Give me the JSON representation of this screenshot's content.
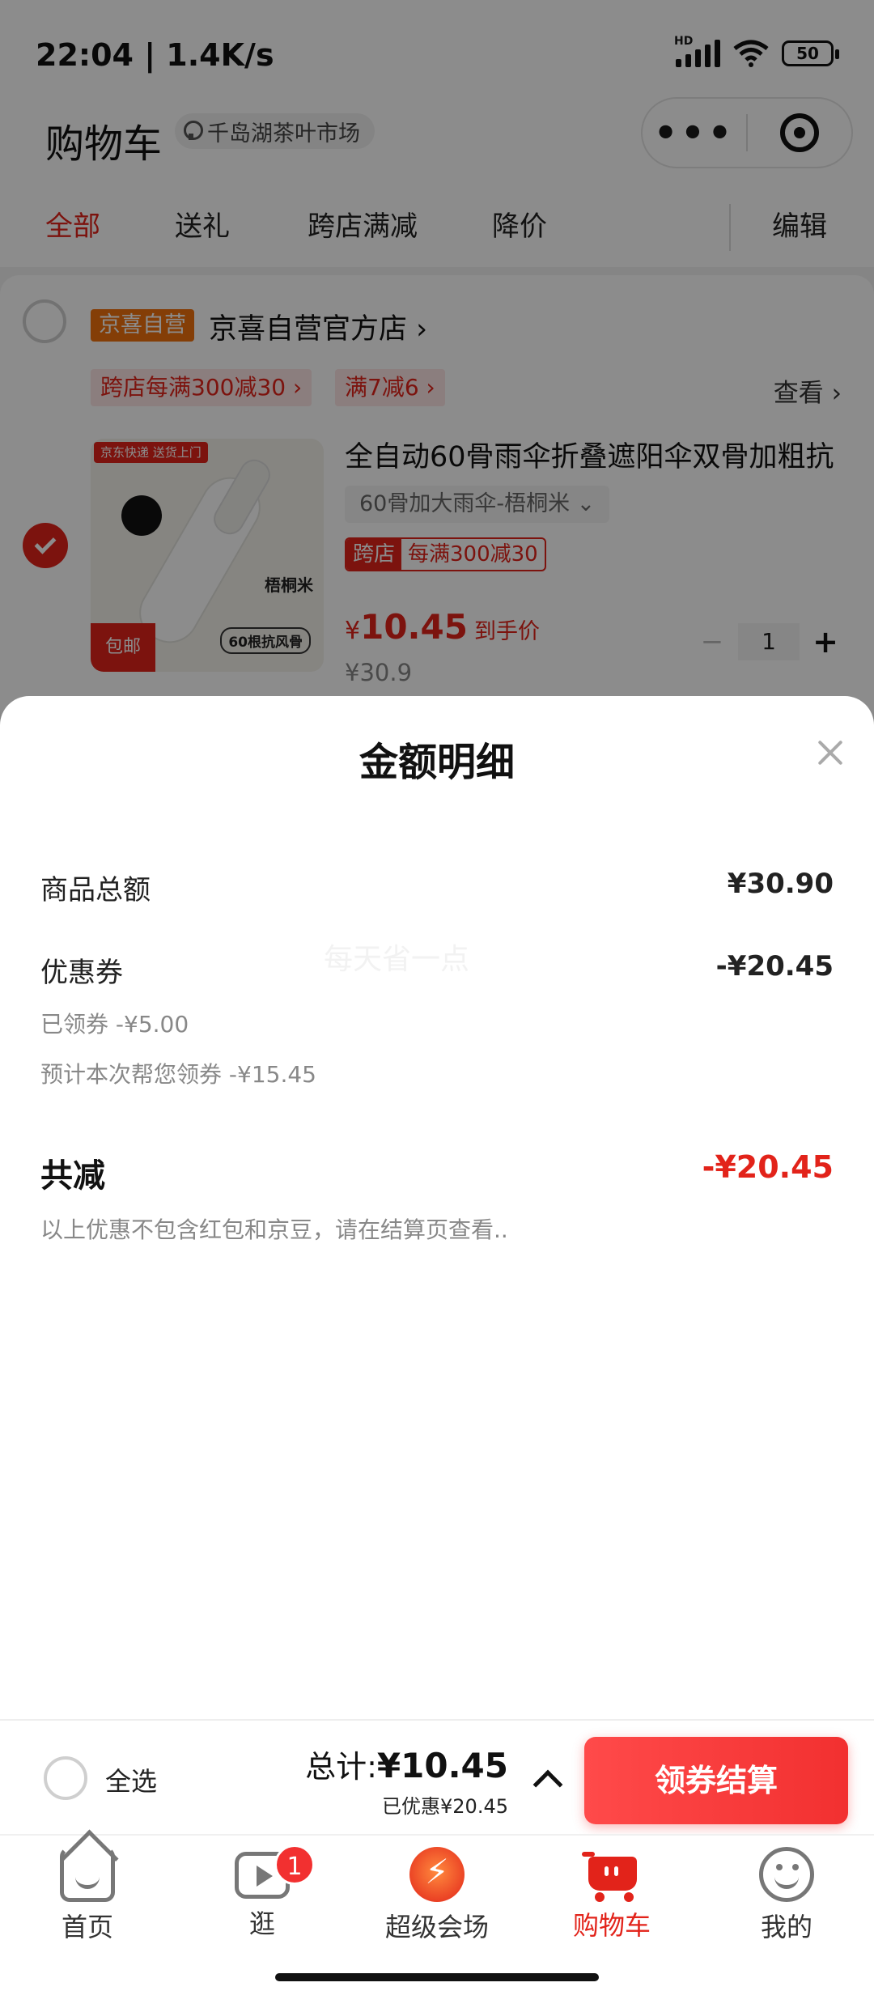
{
  "status_bar": {
    "time": "22:04 | 1.4K/s",
    "battery": "50",
    "hd": "HD"
  },
  "header": {
    "title": "购物车",
    "location": "千岛湖茶叶市场",
    "capsule_more": "•••"
  },
  "tabs": [
    "全部",
    "送礼",
    "跨店满减",
    "降价"
  ],
  "edit_label": "编辑",
  "store": {
    "badge": "京喜自营",
    "name": "京喜自营官方店 ›",
    "promos": [
      "跨店每满300减30 ›",
      "满7减6 ›"
    ],
    "view_label": "查看 ›"
  },
  "product": {
    "title": "全自动60骨雨伞折叠遮阳伞双骨加粗抗",
    "spec": "60骨加大雨伞-梧桐米  ⌄",
    "cross_tag": "跨店",
    "cross_promo": "每满300减30",
    "price_symbol": "¥",
    "price": "10.45",
    "price_note": "到手价",
    "original_price": "¥30.9",
    "quantity": "1",
    "image_tags": {
      "tag1": "京东快递 送货上门",
      "name": "梧桐米",
      "tag2": "包邮",
      "tag3": "60根抗风骨"
    }
  },
  "sheet": {
    "title": "金额明细",
    "watermark": "每天省一点",
    "rows": {
      "goods_total_label": "商品总额",
      "goods_total_value": "¥30.90",
      "coupon_label": "优惠券",
      "coupon_value": "-¥20.45",
      "claimed": "已领券 -¥5.00",
      "estimated": "预计本次帮您领券 -¥15.45",
      "total_reduce_label": "共减",
      "total_reduce_value": "-¥20.45",
      "note": "以上优惠不包含红包和京豆，请在结算页查看.."
    }
  },
  "checkout": {
    "select_all": "全选",
    "total_prefix": "总计:",
    "total": "¥10.45",
    "saved": "已优惠¥20.45",
    "button": "领券结算"
  },
  "tab_bar": {
    "items": [
      {
        "label": "首页",
        "icon": "home-icon"
      },
      {
        "label": "逛",
        "icon": "video-icon",
        "badge": "1"
      },
      {
        "label": "超级会场",
        "icon": "super-venue-icon"
      },
      {
        "label": "购物车",
        "icon": "cart-icon",
        "active": true
      },
      {
        "label": "我的",
        "icon": "profile-icon"
      }
    ]
  },
  "colors": {
    "accent": "#e2231a",
    "checkout_button": "#f23030"
  }
}
